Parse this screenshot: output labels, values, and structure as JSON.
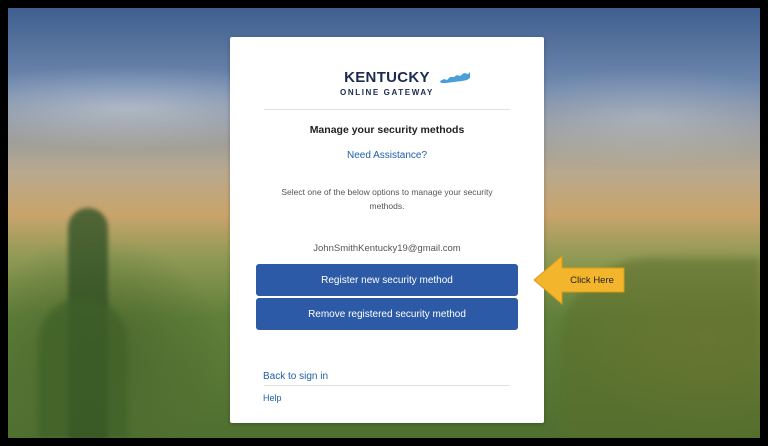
{
  "logo": {
    "word": "KENTUCKY",
    "subtitle": "ONLINE GATEWAY"
  },
  "page": {
    "title": "Manage your security methods",
    "assistance_link": "Need Assistance?",
    "description": "Select one of the below options to manage your security methods.",
    "email": "JohnSmithKentucky19@gmail.com"
  },
  "actions": {
    "register": "Register new security method",
    "remove": "Remove registered security method"
  },
  "footer": {
    "back": "Back to sign in",
    "help": "Help"
  },
  "callout": {
    "label": "Click Here"
  },
  "colors": {
    "primary_button": "#2c5aa6",
    "link": "#1f5fa8",
    "logo_text": "#1b2a4e",
    "logo_accent": "#4a9fd8",
    "callout_fill": "#f3b52b"
  }
}
